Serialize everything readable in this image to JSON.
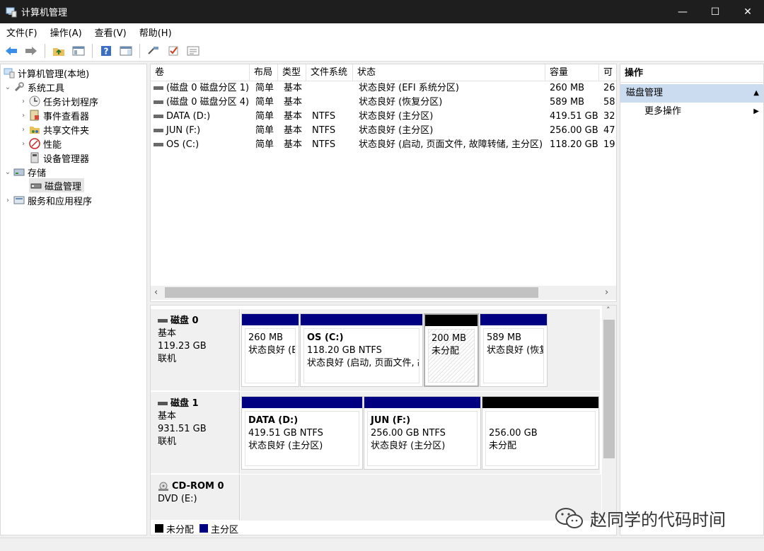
{
  "window": {
    "title": "计算机管理",
    "controls": {
      "minimize": "—",
      "maximize": "☐",
      "close": "✕"
    }
  },
  "menu": [
    "文件(F)",
    "操作(A)",
    "查看(V)",
    "帮助(H)"
  ],
  "toolbar": [
    "back-arrow-icon",
    "forward-arrow-icon",
    "up-folder-icon",
    "show-hide-tree-icon",
    "help-icon",
    "properties-panel-icon",
    "rescan-icon",
    "check-icon",
    "settings-list-icon"
  ],
  "tree": {
    "root": "计算机管理(本地)",
    "system_tools": "系统工具",
    "task_scheduler": "任务计划程序",
    "event_viewer": "事件查看器",
    "shared_folders": "共享文件夹",
    "performance": "性能",
    "device_manager": "设备管理器",
    "storage": "存储",
    "disk_management": "磁盘管理",
    "services_apps": "服务和应用程序"
  },
  "volume_list": {
    "headers": [
      "卷",
      "布局",
      "类型",
      "文件系统",
      "状态",
      "容量",
      "可"
    ],
    "rows": [
      [
        "(磁盘 0 磁盘分区 1)",
        "简单",
        "基本",
        "",
        "状态良好 (EFI 系统分区)",
        "260 MB",
        "26"
      ],
      [
        "(磁盘 0 磁盘分区 4)",
        "简单",
        "基本",
        "",
        "状态良好 (恢复分区)",
        "589 MB",
        "58"
      ],
      [
        "DATA (D:)",
        "简单",
        "基本",
        "NTFS",
        "状态良好 (主分区)",
        "419.51 GB",
        "32"
      ],
      [
        "JUN (F:)",
        "简单",
        "基本",
        "NTFS",
        "状态良好 (主分区)",
        "256.00 GB",
        "47"
      ],
      [
        "OS (C:)",
        "简单",
        "基本",
        "NTFS",
        "状态良好 (启动, 页面文件, 故障转储, 主分区)",
        "118.20 GB",
        "19"
      ]
    ]
  },
  "disks": [
    {
      "name": "磁盘 0",
      "type": "基本",
      "size": "119.23 GB",
      "status": "联机",
      "partitions": [
        {
          "name": "",
          "size": "260 MB",
          "status": "状态良好 (E",
          "kind": "primary"
        },
        {
          "name": "OS  (C:)",
          "size": "118.20 GB NTFS",
          "status": "状态良好 (启动, 页面文件, 故",
          "kind": "primary"
        },
        {
          "name": "",
          "size": "200 MB",
          "status": "未分配",
          "kind": "unallocated"
        },
        {
          "name": "",
          "size": "589 MB",
          "status": "状态良好 (恢复",
          "kind": "primary"
        }
      ]
    },
    {
      "name": "磁盘 1",
      "type": "基本",
      "size": "931.51 GB",
      "status": "联机",
      "partitions": [
        {
          "name": "DATA  (D:)",
          "size": "419.51 GB NTFS",
          "status": "状态良好 (主分区)",
          "kind": "primary"
        },
        {
          "name": "JUN  (F:)",
          "size": "256.00 GB NTFS",
          "status": "状态良好 (主分区)",
          "kind": "primary"
        },
        {
          "name": "",
          "size": "256.00 GB",
          "status": "未分配",
          "kind": "unallocated"
        }
      ]
    },
    {
      "name": "CD-ROM 0",
      "type": "DVD (E:)",
      "size": "",
      "status": "",
      "partitions": []
    }
  ],
  "legend": {
    "unallocated": "未分配",
    "primary": "主分区"
  },
  "colors": {
    "primary": "#000080",
    "unallocated": "#000000",
    "selection": "#cbdcf0"
  },
  "actions": {
    "header": "操作",
    "section": "磁盘管理",
    "more": "更多操作"
  },
  "watermark": "赵同学的代码时间"
}
